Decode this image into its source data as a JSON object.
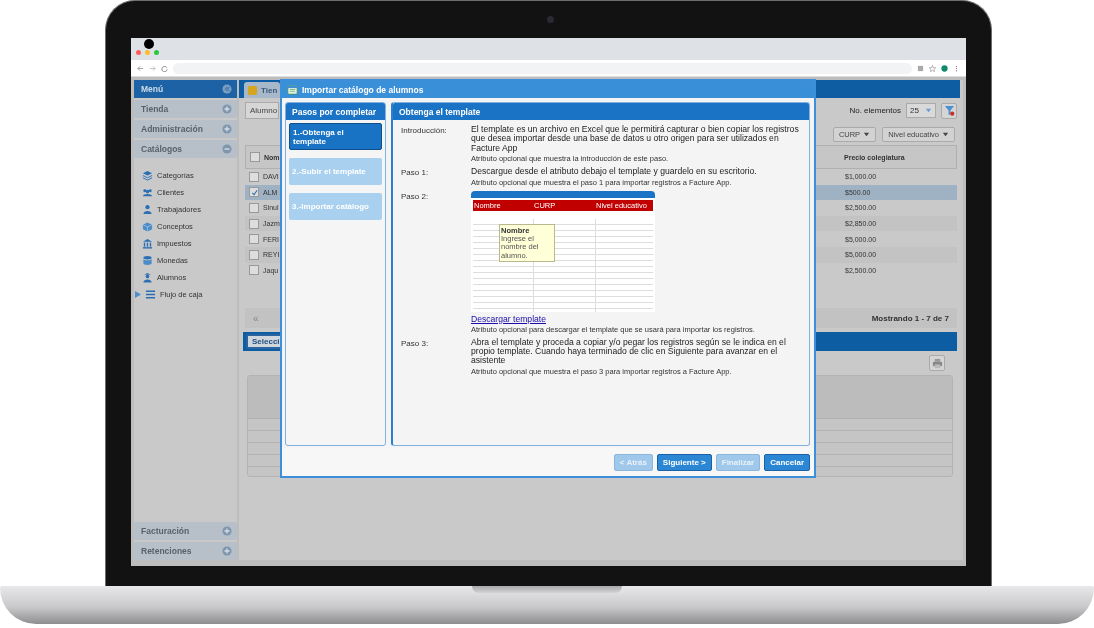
{
  "sidebar": {
    "title": "Menú",
    "sections": [
      {
        "label": "Tienda",
        "expanded": false
      },
      {
        "label": "Administración",
        "expanded": false
      },
      {
        "label": "Catálogos",
        "expanded": true,
        "items": [
          {
            "label": "Categorías",
            "kind": "leaf"
          },
          {
            "label": "Clientes",
            "kind": "leaf"
          },
          {
            "label": "Trabajadores",
            "kind": "leaf"
          },
          {
            "label": "Conceptos",
            "kind": "leaf"
          },
          {
            "label": "Impuestos",
            "kind": "leaf"
          },
          {
            "label": "Monedas",
            "kind": "leaf"
          },
          {
            "label": "Alumnos",
            "kind": "leaf"
          },
          {
            "label": "Flujo de caja",
            "kind": "group",
            "expanded": false
          }
        ]
      }
    ],
    "bottom_sections": [
      {
        "label": "Facturación",
        "expanded": false
      },
      {
        "label": "Retenciones",
        "expanded": false
      }
    ]
  },
  "main": {
    "tab": "Tien",
    "search": {
      "value": "Alumno"
    },
    "page_size": {
      "label": "No. elementos",
      "value": "25"
    },
    "filters": [
      "CURP",
      "Nivel educativo"
    ],
    "table": {
      "select_all": {
        "checked": false
      },
      "columns": [
        "Nom",
        "Precio colegiatura"
      ],
      "rows": [
        {
          "name": "DAVI",
          "price": "$1,000.00",
          "selected": false
        },
        {
          "name": "ALM",
          "price": "$500.00",
          "selected": true
        },
        {
          "name": "Sinul",
          "price": "$2,500.00",
          "selected": false
        },
        {
          "name": "Jazm",
          "price": "$2,850.00",
          "selected": false
        },
        {
          "name": "FERI",
          "price": "$5,000.00",
          "selected": false
        },
        {
          "name": "REYI",
          "price": "$5,000.00",
          "selected": false
        },
        {
          "name": "Jaqu",
          "price": "$2,500.00",
          "selected": false
        }
      ]
    },
    "pager": {
      "first": "«",
      "summary": "Mostrando 1 - 7 de 7"
    },
    "select_button": "Selecci"
  },
  "modal": {
    "title": "Importar catálogo de alumnos",
    "steps_title": "Pasos por completar",
    "steps": [
      {
        "label": "1.-Obtenga el template",
        "selected": true
      },
      {
        "label": "2.-Subir el template",
        "selected": false
      },
      {
        "label": "3.-Importar catálogo",
        "selected": false
      }
    ],
    "panel_title": "Obtenga el template",
    "fields": [
      {
        "kind": "text",
        "label": "Introducción:",
        "text": "El template es un archivo en Excel que le permitirá capturar o bien copiar los registros que desea importar desde una base de datos u otro origen para ser utilizados en Facture App",
        "note": "Atributo opcional que muestra la introducción de este paso."
      },
      {
        "kind": "text",
        "label": "Paso 1:",
        "text": "Descargue desde el atributo debajo el template y guardelo en su escritorio.",
        "note": "Atributo opcional que muestra el paso 1 para importar registros a Facture App."
      },
      {
        "kind": "template",
        "label": "Paso 2:",
        "columns": [
          "Nombre",
          "CURP",
          "Nivel educativo"
        ],
        "tooltip_title": "Nombre",
        "tooltip_text": "Ingrese el nombre del alumno.",
        "link": "Descargar template",
        "note": "Atributo opcional para descargar el template que se usará para importar los registros."
      },
      {
        "kind": "text",
        "label": "Paso 3:",
        "text": "Abra el template y proceda a copiar y/o pegar los registros según se le indica en el propio template. Cuando haya terminado de clic en Siguiente para avanzar en el asistente",
        "note": "Atributo opcional que muestra el paso 3 para importar registros a Facture App."
      }
    ],
    "buttons": [
      {
        "label": "< Atrás",
        "disabled": true
      },
      {
        "label": "Siguiente >",
        "disabled": false
      },
      {
        "label": "Finalizar",
        "disabled": true
      },
      {
        "label": "Cancelar",
        "disabled": false
      }
    ]
  }
}
